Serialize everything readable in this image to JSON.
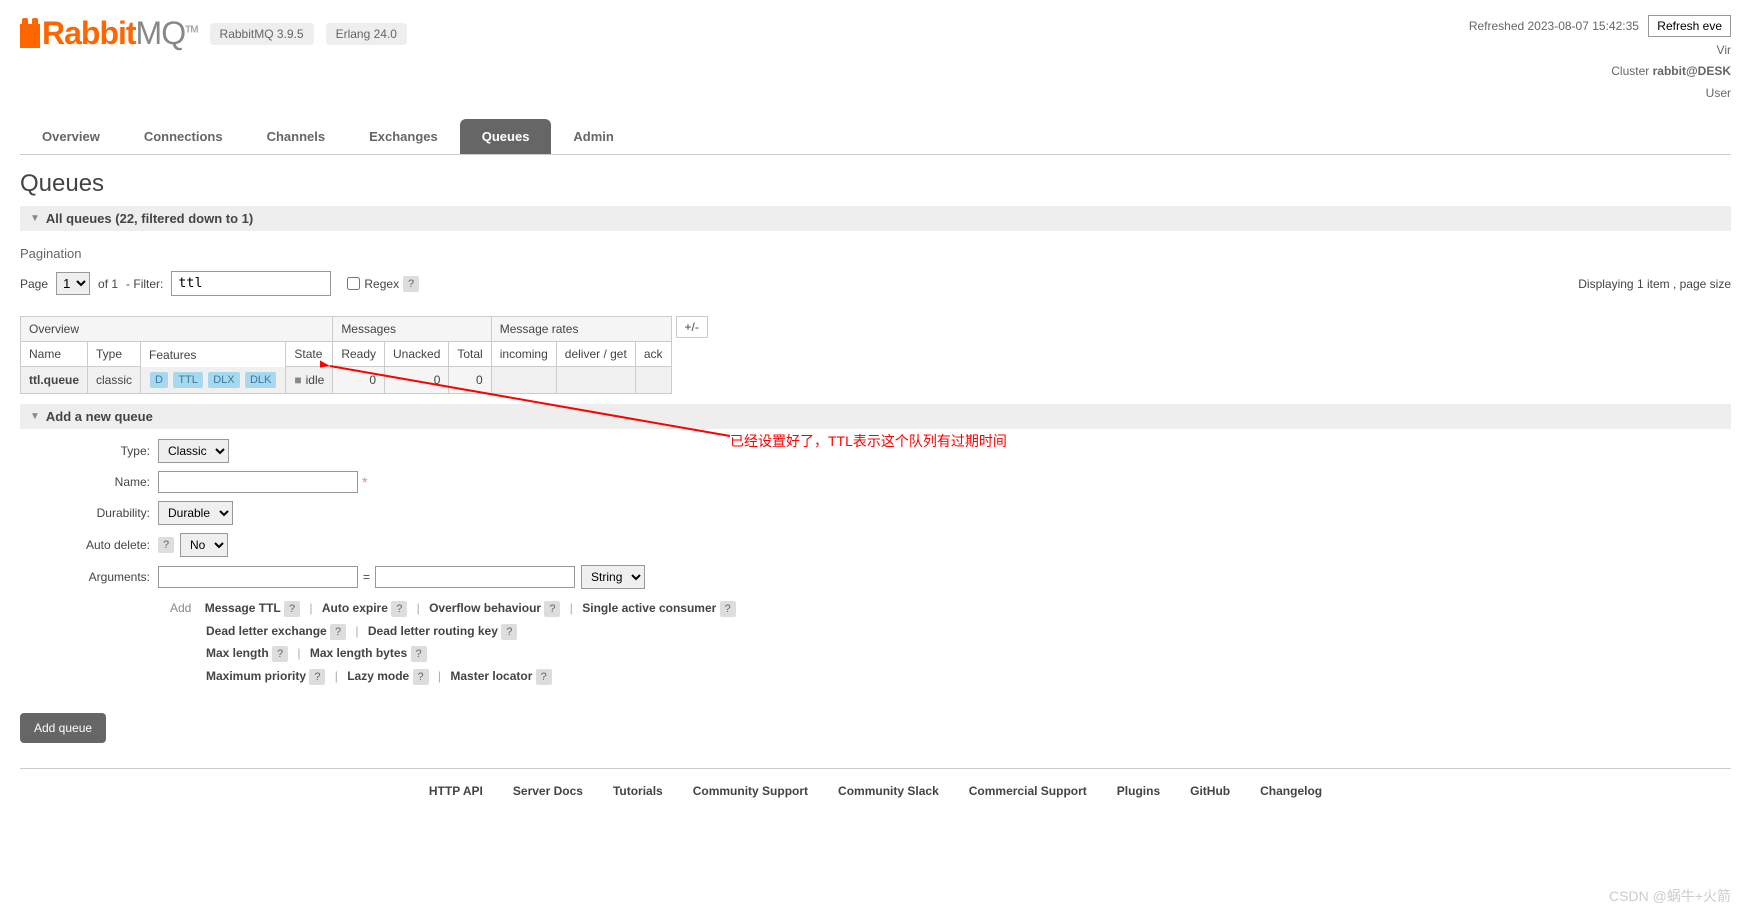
{
  "header": {
    "logo_text_rabbit": "Rabbit",
    "logo_text_mq": "MQ",
    "logo_tm": "TM",
    "version_rabbitmq": "RabbitMQ 3.9.5",
    "version_erlang": "Erlang 24.0",
    "refreshed": "Refreshed 2023-08-07 15:42:35",
    "refresh_btn": "Refresh eve",
    "virtual": "Vir",
    "cluster_label": "Cluster",
    "cluster_value": "rabbit@DESK",
    "user_label": "User"
  },
  "tabs": [
    "Overview",
    "Connections",
    "Channels",
    "Exchanges",
    "Queues",
    "Admin"
  ],
  "active_tab": "Queues",
  "page_title": "Queues",
  "all_queues_header": "All queues (22, filtered down to 1)",
  "pagination_label": "Pagination",
  "page_label": "Page",
  "page_of": "of 1",
  "filter_label": "- Filter:",
  "filter_value": "ttl",
  "regex_label": "Regex",
  "displaying": "Displaying 1 item , page size",
  "table": {
    "group_headers": [
      "Overview",
      "Messages",
      "Message rates"
    ],
    "headers": [
      "Name",
      "Type",
      "Features",
      "State",
      "Ready",
      "Unacked",
      "Total",
      "incoming",
      "deliver / get",
      "ack"
    ],
    "plus_minus": "+/-",
    "row": {
      "name": "ttl.queue",
      "type": "classic",
      "features": [
        "D",
        "TTL",
        "DLX",
        "DLK"
      ],
      "state": "idle",
      "ready": "0",
      "unacked": "0",
      "total": "0",
      "incoming": "",
      "deliver_get": "",
      "ack": ""
    }
  },
  "add_queue_header": "Add a new queue",
  "form": {
    "type_label": "Type:",
    "type_options": [
      "Classic"
    ],
    "name_label": "Name:",
    "durability_label": "Durability:",
    "durability_options": [
      "Durable"
    ],
    "auto_delete_label": "Auto delete:",
    "auto_delete_options": [
      "No"
    ],
    "arguments_label": "Arguments:",
    "arg_type_options": [
      "String"
    ],
    "add_label": "Add",
    "helpers_line1": [
      "Message TTL",
      "Auto expire",
      "Overflow behaviour",
      "Single active consumer"
    ],
    "helpers_line2": [
      "Dead letter exchange",
      "Dead letter routing key"
    ],
    "helpers_line3": [
      "Max length",
      "Max length bytes"
    ],
    "helpers_line4": [
      "Maximum priority",
      "Lazy mode",
      "Master locator"
    ]
  },
  "add_queue_btn": "Add queue",
  "footer": [
    "HTTP API",
    "Server Docs",
    "Tutorials",
    "Community Support",
    "Community Slack",
    "Commercial Support",
    "Plugins",
    "GitHub",
    "Changelog"
  ],
  "annotation": "已经设置好了，TTL表示这个队列有过期时间",
  "watermark": "CSDN @蜗牛+火箭"
}
